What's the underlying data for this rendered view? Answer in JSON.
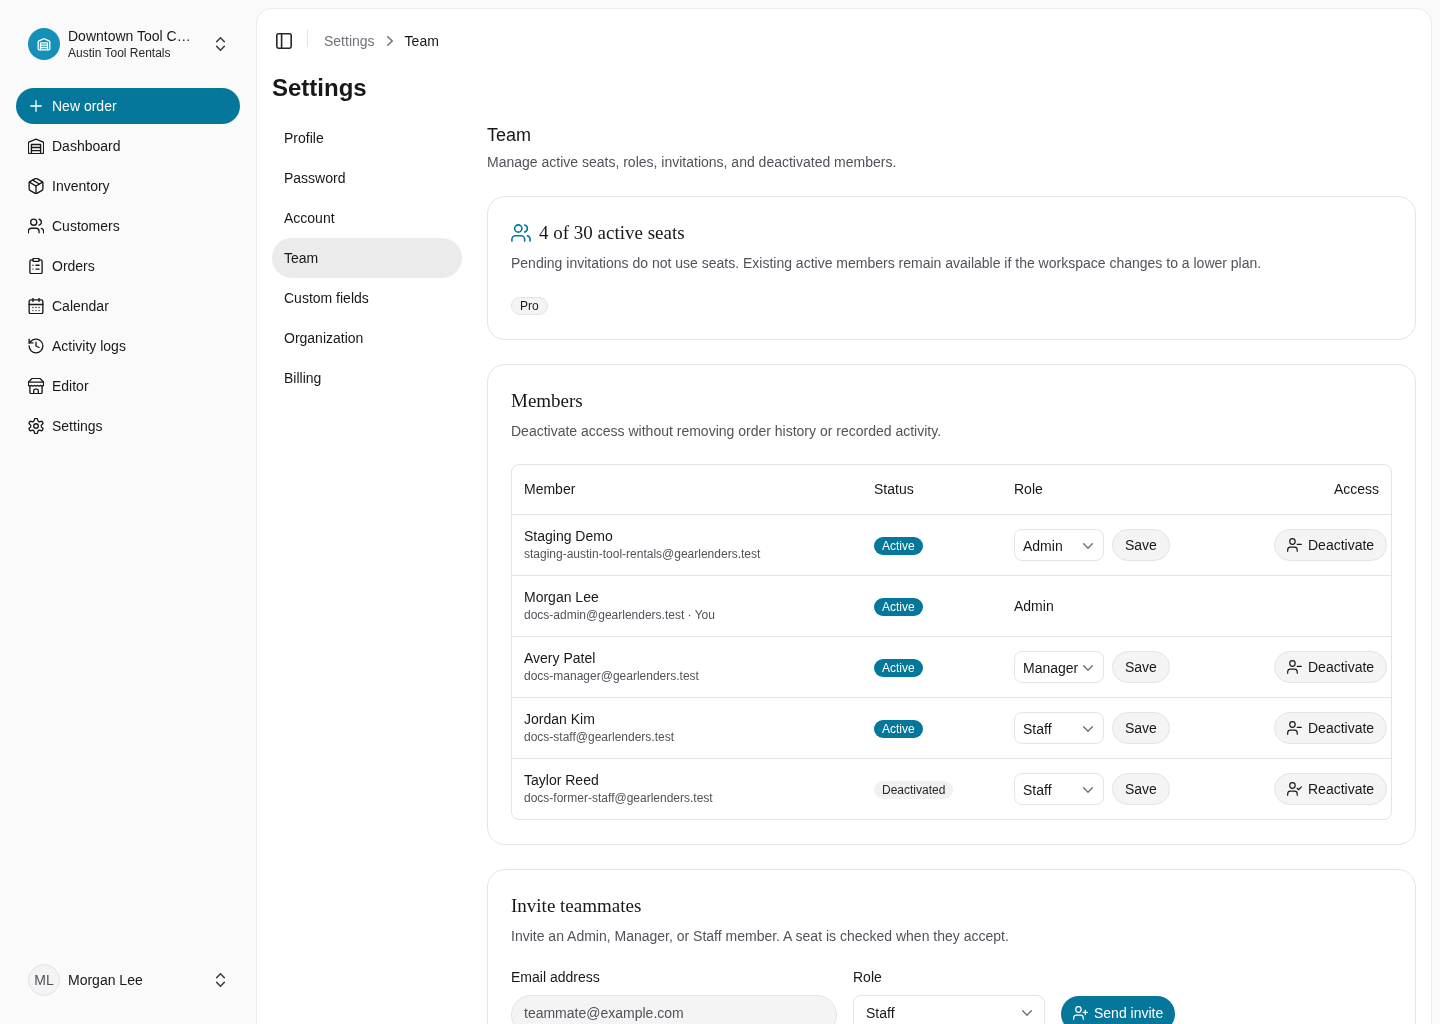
{
  "sidebar": {
    "workspace": {
      "name": "Downtown Tool C…",
      "subtitle": "Austin Tool Rentals"
    },
    "new_order_button": "New order",
    "items": [
      {
        "label": "Dashboard",
        "selected": false
      },
      {
        "label": "Inventory",
        "selected": false
      },
      {
        "label": "Customers",
        "selected": false
      },
      {
        "label": "Orders",
        "selected": false
      },
      {
        "label": "Calendar",
        "selected": false
      },
      {
        "label": "Activity logs",
        "selected": false
      },
      {
        "label": "Editor",
        "selected": false
      },
      {
        "label": "Settings",
        "selected": false
      }
    ],
    "user": {
      "initials": "ML",
      "name": "Morgan Lee"
    }
  },
  "breadcrumb": [
    "Settings",
    "Team"
  ],
  "page_title": "Settings",
  "settings_nav": [
    {
      "label": "Profile",
      "selected": false
    },
    {
      "label": "Password",
      "selected": false
    },
    {
      "label": "Account",
      "selected": false
    },
    {
      "label": "Team",
      "selected": true
    },
    {
      "label": "Custom fields",
      "selected": false
    },
    {
      "label": "Organization",
      "selected": false
    },
    {
      "label": "Billing",
      "selected": false
    }
  ],
  "section": {
    "title": "Team",
    "description": "Manage active seats, roles, invitations, and deactivated members."
  },
  "seats_card": {
    "title": "4 of 30 active seats",
    "description": "Pending invitations do not use seats. Existing active members remain available if the workspace changes to a lower plan.",
    "plan_badge": "Pro"
  },
  "members_card": {
    "title": "Members",
    "description": "Deactivate access without removing order history or recorded activity.",
    "table": {
      "columns": [
        "Member",
        "Status",
        "Role",
        "Access"
      ],
      "rows": [
        {
          "name": "Staging Demo",
          "email": "staging-austin-tool-rentals@gearlenders.test",
          "status": {
            "label": "Active",
            "kind": "active"
          },
          "role": {
            "kind": "select",
            "value": "Admin"
          },
          "save_button": "Save",
          "access": {
            "kind": "deactivate",
            "label": "Deactivate"
          }
        },
        {
          "name": "Morgan Lee",
          "email": "docs-admin@gearlenders.test · You",
          "status": {
            "label": "Active",
            "kind": "active"
          },
          "role": {
            "kind": "text",
            "value": "Admin"
          }
        },
        {
          "name": "Avery Patel",
          "email": "docs-manager@gearlenders.test",
          "status": {
            "label": "Active",
            "kind": "active"
          },
          "role": {
            "kind": "select",
            "value": "Manager"
          },
          "save_button": "Save",
          "access": {
            "kind": "deactivate",
            "label": "Deactivate"
          }
        },
        {
          "name": "Jordan Kim",
          "email": "docs-staff@gearlenders.test",
          "status": {
            "label": "Active",
            "kind": "active"
          },
          "role": {
            "kind": "select",
            "value": "Staff"
          },
          "save_button": "Save",
          "access": {
            "kind": "deactivate",
            "label": "Deactivate"
          }
        },
        {
          "name": "Taylor Reed",
          "email": "docs-former-staff@gearlenders.test",
          "status": {
            "label": "Deactivated",
            "kind": "inactive"
          },
          "role": {
            "kind": "select",
            "value": "Staff"
          },
          "save_button": "Save",
          "access": {
            "kind": "reactivate",
            "label": "Reactivate"
          }
        }
      ]
    }
  },
  "invite_card": {
    "title": "Invite teammates",
    "description": "Invite an Admin, Manager, or Staff member. A seat is checked when they accept.",
    "email": {
      "label": "Email address",
      "placeholder": "teammate@example.com"
    },
    "role": {
      "label": "Role",
      "value": "Staff"
    },
    "submit_button": "Send invite"
  }
}
